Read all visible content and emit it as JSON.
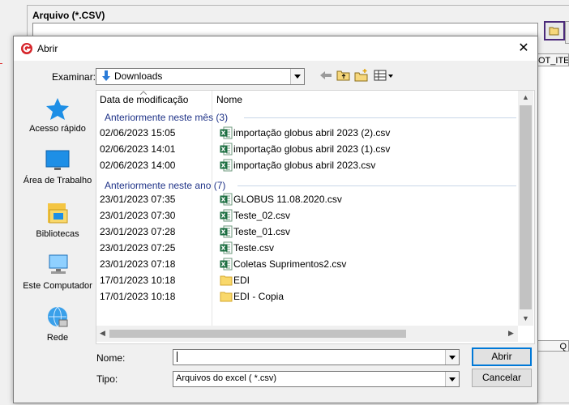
{
  "background": {
    "field_label": "Arquivo (*.CSV)",
    "grid_header": "OT_ITE",
    "grid_footer": "Q"
  },
  "dialog": {
    "title": "Abrir",
    "look_in_label": "Examinar:",
    "look_in_value": "Downloads",
    "places": [
      {
        "label": "Acesso rápido",
        "icon": "star-icon"
      },
      {
        "label": "Área de Trabalho",
        "icon": "desktop-icon"
      },
      {
        "label": "Bibliotecas",
        "icon": "libraries-icon"
      },
      {
        "label": "Este Computador",
        "icon": "computer-icon"
      },
      {
        "label": "Rede",
        "icon": "network-icon"
      }
    ],
    "columns": {
      "date": "Data de modificação",
      "name": "Nome"
    },
    "groups": [
      {
        "label": "Anteriormente neste mês (3)"
      },
      {
        "label": "Anteriormente neste ano (7)"
      }
    ],
    "files": [
      {
        "date": "02/06/2023 15:05",
        "name": "importação globus abril 2023 (2).csv",
        "type": "excel"
      },
      {
        "date": "02/06/2023 14:01",
        "name": "importação globus abril 2023 (1).csv",
        "type": "excel"
      },
      {
        "date": "02/06/2023 14:00",
        "name": "importação globus abril 2023.csv",
        "type": "excel"
      },
      {
        "date": "23/01/2023 07:35",
        "name": "GLOBUS 11.08.2020.csv",
        "type": "excel"
      },
      {
        "date": "23/01/2023 07:30",
        "name": "Teste_02.csv",
        "type": "excel"
      },
      {
        "date": "23/01/2023 07:28",
        "name": "Teste_01.csv",
        "type": "excel"
      },
      {
        "date": "23/01/2023 07:25",
        "name": "Teste.csv",
        "type": "excel"
      },
      {
        "date": "23/01/2023 07:18",
        "name": "Coletas Suprimentos2.csv",
        "type": "excel"
      },
      {
        "date": "17/01/2023 10:18",
        "name": "EDI",
        "type": "folder"
      },
      {
        "date": "17/01/2023 10:18",
        "name": "EDI - Copia",
        "type": "folder"
      }
    ],
    "filename_label": "Nome:",
    "filename_value": "",
    "filetype_label": "Tipo:",
    "filetype_value": "Arquivos do excel ( *.csv)",
    "open_button": "Abrir",
    "cancel_button": "Cancelar"
  },
  "colors": {
    "accent": "#0078d7",
    "group_text": "#1e3287",
    "excel_green": "#1d6f42"
  }
}
